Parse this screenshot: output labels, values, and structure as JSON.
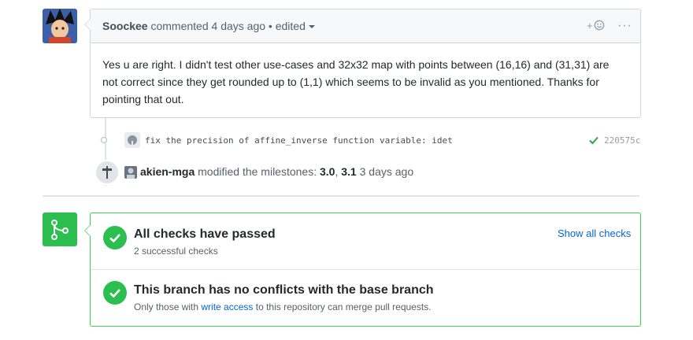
{
  "comment": {
    "author": "Soockee",
    "action": " commented ",
    "time": "4 days ago",
    "separator": " • ",
    "edited": "edited",
    "reaction_plus": "+",
    "more": "···",
    "body": "Yes u are right. I didn't test other use-cases and 32x32 map with points between (16,16) and (31,31) are not correct since they get rounded up to (1,1) which seems to be invalid as you mentioned. Thanks for pointing that out."
  },
  "commit": {
    "message": "fix the precision of affine_inverse function variable: idet",
    "sha": "220575c"
  },
  "milestone": {
    "user": "akien-mga",
    "action": " modified the milestones: ",
    "from": "3.0",
    "comma": ", ",
    "to": "3.1",
    "time": " 3 days ago"
  },
  "merge": {
    "checks_title": "All checks have passed",
    "checks_sub": "2 successful checks",
    "show_all": "Show all checks",
    "conflict_title": "This branch has no conflicts with the base branch",
    "conflict_sub_before": "Only those with ",
    "conflict_link": "write access",
    "conflict_sub_after": " to this repository can merge pull requests."
  },
  "colors": {
    "success": "#2cbe4e",
    "link": "#0366d6",
    "border": "#d1d5da"
  }
}
